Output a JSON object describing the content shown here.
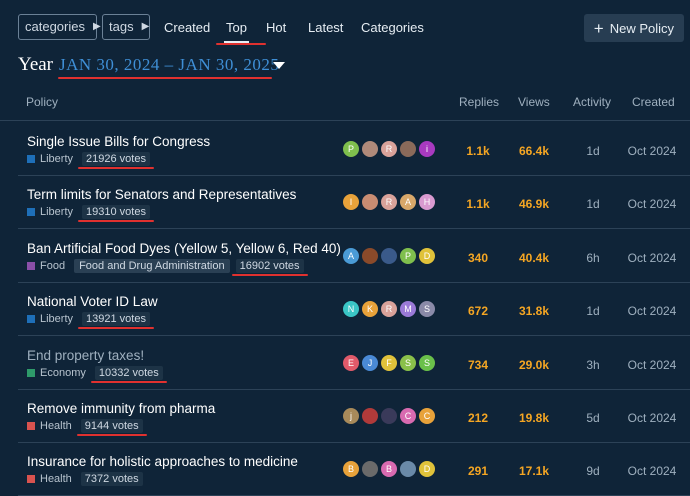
{
  "filters": {
    "categories_label": "categories",
    "tags_label": "tags"
  },
  "nav": [
    "Created",
    "Top",
    "Hot",
    "Latest",
    "Categories"
  ],
  "new_policy_label": "New Policy",
  "year": {
    "label": "Year",
    "range": "JAN 30, 2024 – JAN 30, 2025"
  },
  "headers": {
    "policy": "Policy",
    "replies": "Replies",
    "views": "Views",
    "activity": "Activity",
    "created": "Created"
  },
  "rows": [
    {
      "title": "Single Issue Bills for Congress",
      "category": "Liberty",
      "cat_color": "#1e6fb8",
      "tag": "",
      "votes": "21926 votes",
      "avatars": [
        {
          "l": "P",
          "c": "#7fbf4d"
        },
        {
          "l": "",
          "c": "#b08a7a"
        },
        {
          "l": "R",
          "c": "#d9a29a"
        },
        {
          "l": "",
          "c": "#8a6a5a"
        },
        {
          "l": "i",
          "c": "#a83ac0"
        }
      ],
      "replies": "1.1k",
      "views": "66.4k",
      "activity": "1d",
      "created": "Oct 2024",
      "muted": false
    },
    {
      "title": "Term limits for Senators and Representatives",
      "category": "Liberty",
      "cat_color": "#1e6fb8",
      "tag": "",
      "votes": "19310 votes",
      "avatars": [
        {
          "l": "I",
          "c": "#e8a23a"
        },
        {
          "l": "",
          "c": "#c98c72"
        },
        {
          "l": "R",
          "c": "#d9a29a"
        },
        {
          "l": "A",
          "c": "#d8a86a"
        },
        {
          "l": "H",
          "c": "#d99ad0"
        }
      ],
      "replies": "1.1k",
      "views": "46.9k",
      "activity": "1d",
      "created": "Oct 2024",
      "muted": false
    },
    {
      "title": "Ban Artificial Food Dyes (Yellow 5, Yellow 6, Red 40)",
      "category": "Food",
      "cat_color": "#8a4fa8",
      "tag": "Food and Drug Administration",
      "votes": "16902 votes",
      "avatars": [
        {
          "l": "A",
          "c": "#4a9bd6"
        },
        {
          "l": "",
          "c": "#8a4a2a"
        },
        {
          "l": "",
          "c": "#3a5a8a"
        },
        {
          "l": "P",
          "c": "#7fbf4d"
        },
        {
          "l": "D",
          "c": "#e0c23a"
        }
      ],
      "replies": "340",
      "views": "40.4k",
      "activity": "6h",
      "created": "Oct 2024",
      "muted": false
    },
    {
      "title": "National Voter ID Law",
      "category": "Liberty",
      "cat_color": "#1e6fb8",
      "tag": "",
      "votes": "13921 votes",
      "avatars": [
        {
          "l": "N",
          "c": "#3ac6c6"
        },
        {
          "l": "K",
          "c": "#e8a23a"
        },
        {
          "l": "R",
          "c": "#d9a29a"
        },
        {
          "l": "M",
          "c": "#9a7ad8"
        },
        {
          "l": "S",
          "c": "#8a8aa8"
        }
      ],
      "replies": "672",
      "views": "31.8k",
      "activity": "1d",
      "created": "Oct 2024",
      "muted": false
    },
    {
      "title": "End property taxes!",
      "category": "Economy",
      "cat_color": "#2e9a6a",
      "tag": "",
      "votes": "10332 votes",
      "avatars": [
        {
          "l": "E",
          "c": "#e05a6a"
        },
        {
          "l": "J",
          "c": "#4a8ad6"
        },
        {
          "l": "F",
          "c": "#e0c23a"
        },
        {
          "l": "S",
          "c": "#8ac04a"
        },
        {
          "l": "S",
          "c": "#6ac04a"
        }
      ],
      "replies": "734",
      "views": "29.0k",
      "activity": "3h",
      "created": "Oct 2024",
      "muted": true
    },
    {
      "title": "Remove immunity from pharma",
      "category": "Health",
      "cat_color": "#d9534f",
      "tag": "",
      "votes": "9144 votes",
      "avatars": [
        {
          "l": "j",
          "c": "#a88a5a"
        },
        {
          "l": "",
          "c": "#b03a3a"
        },
        {
          "l": "",
          "c": "#3a3a5a"
        },
        {
          "l": "C",
          "c": "#d86ab0"
        },
        {
          "l": "C",
          "c": "#e8a23a"
        }
      ],
      "replies": "212",
      "views": "19.8k",
      "activity": "5d",
      "created": "Oct 2024",
      "muted": false
    },
    {
      "title": "Insurance for holistic approaches to medicine",
      "category": "Health",
      "cat_color": "#d9534f",
      "tag": "",
      "votes": "7372 votes",
      "avatars": [
        {
          "l": "B",
          "c": "#e8a23a"
        },
        {
          "l": "",
          "c": "#6a6a6a"
        },
        {
          "l": "B",
          "c": "#d86ab0"
        },
        {
          "l": "",
          "c": "#6a8aa8"
        },
        {
          "l": "D",
          "c": "#e0c23a"
        }
      ],
      "replies": "291",
      "views": "17.1k",
      "activity": "9d",
      "created": "Oct 2024",
      "muted": false
    }
  ],
  "colors": {
    "background": "#0f2438",
    "accent": "#3f8fd6",
    "stat": "#f5a623",
    "annotation": "#e0312f"
  }
}
